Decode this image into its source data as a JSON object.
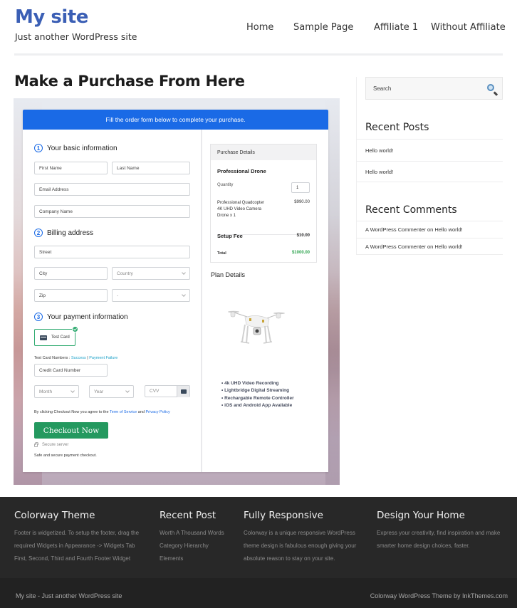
{
  "header": {
    "site_title": "My site",
    "tagline": "Just another WordPress site",
    "nav": [
      "Home",
      "Sample Page",
      "Affiliate 1",
      "Without Affiliate"
    ]
  },
  "page": {
    "title": "Make a Purchase From Here"
  },
  "form": {
    "banner": "Fill the order form below to complete your purchase.",
    "sections": {
      "basic": {
        "num": "1",
        "title": "Your basic information"
      },
      "billing": {
        "num": "2",
        "title": "Billing address"
      },
      "payment": {
        "num": "3",
        "title": "Your payment information"
      }
    },
    "fields": {
      "first_name": "First Name",
      "last_name": "Last Name",
      "email": "Email Address",
      "company": "Company Name",
      "street": "Street",
      "city": "City",
      "country": "Country",
      "zip": "Zip",
      "state": "-",
      "card_number": "Credit Card Number",
      "month": "Month",
      "year": "Year",
      "cvv": "CVV"
    },
    "payment_option": "Test Card",
    "test_numbers_label": "Test Card Numbers :",
    "success_link": "Success",
    "separator": "|",
    "failure_link": "Payment Failure",
    "agree_prefix": "By clicking Checkout Now you agree to the",
    "terms_link": "Term of Service",
    "and": "and",
    "privacy_link": "Privacy Policy",
    "checkout_button": "Checkout Now",
    "secure_server": "Secure server",
    "safe_text": "Safe and secure payment checkout."
  },
  "purchase": {
    "header": "Purchase Details",
    "product": "Professional Drone",
    "quantity_label": "Quantity",
    "quantity_value": "1",
    "item_desc_line1": "Professional Quadcopter",
    "item_desc_line2": "4K UHD Video Camera",
    "item_desc_line3": "Drone x 1",
    "item_price": "$990.00",
    "setup_fee_label": "Setup Fee",
    "setup_fee": "$10.00",
    "total_label": "Total",
    "total": "$1000.00",
    "total_color": "#2ea44f"
  },
  "plan": {
    "title": "Plan Details",
    "features": [
      "• 4k UHD Video Recording",
      "• Lightbridge Digital Streaming",
      "• Rechargable Remote Controller",
      "• iOS and Android App Available"
    ]
  },
  "sidebar": {
    "search_placeholder": "Search",
    "recent_posts_title": "Recent Posts",
    "recent_posts": [
      "Hello world!",
      "Hello world!"
    ],
    "recent_comments_title": "Recent Comments",
    "recent_comments": [
      "A WordPress Commenter on Hello world!",
      "A WordPress Commenter on Hello world!"
    ]
  },
  "footer": {
    "columns": [
      {
        "title": "Colorway Theme",
        "lines": [
          "Footer is widgetized. To setup the footer, drag the",
          "required Widgets in Appearance -> Widgets Tab",
          "First, Second, Third and Fourth Footer Widget"
        ]
      },
      {
        "title": "Recent Post",
        "lines": [
          "Worth A Thousand Words",
          "Category Hierarchy",
          "Elements"
        ]
      },
      {
        "title": "Fully Responsive",
        "lines": [
          "Colorway is a unique responsive WordPress",
          "theme design is fabulous enough giving your",
          "absolute reason to stay on your site."
        ]
      },
      {
        "title": "Design Your Home",
        "lines": [
          "Express your creativity, find inspiration and make",
          "smarter home design choices, faster."
        ]
      }
    ],
    "bottom_left": "My site - Just another WordPress site",
    "bottom_right": "Colorway WordPress Theme by InkThemes.com"
  },
  "colors": {
    "brand": "#3b5fb5",
    "banner": "#1a6ae6",
    "checkout": "#24995f",
    "footer_bg": "#282828"
  }
}
